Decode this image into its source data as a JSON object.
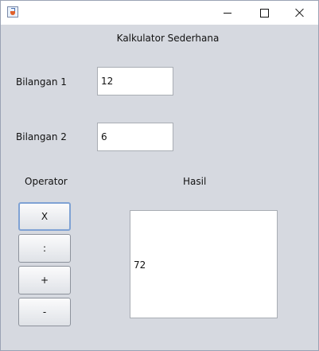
{
  "window": {
    "title_icon": "java-cup-icon",
    "controls": [
      "minimize-icon",
      "maximize-icon",
      "close-icon"
    ]
  },
  "form": {
    "title": "Kalkulator Sederhana",
    "bilangan1": {
      "label": "Bilangan 1",
      "value": "12"
    },
    "bilangan2": {
      "label": "Bilangan 2",
      "value": "6"
    },
    "operator_label": "Operator",
    "operators": [
      "X",
      ":",
      "+",
      "-"
    ],
    "result_label": "Hasil",
    "result_value": "72"
  },
  "colors": {
    "window_bg": "#d6d9e0",
    "focus_border": "#7fa2d4"
  }
}
